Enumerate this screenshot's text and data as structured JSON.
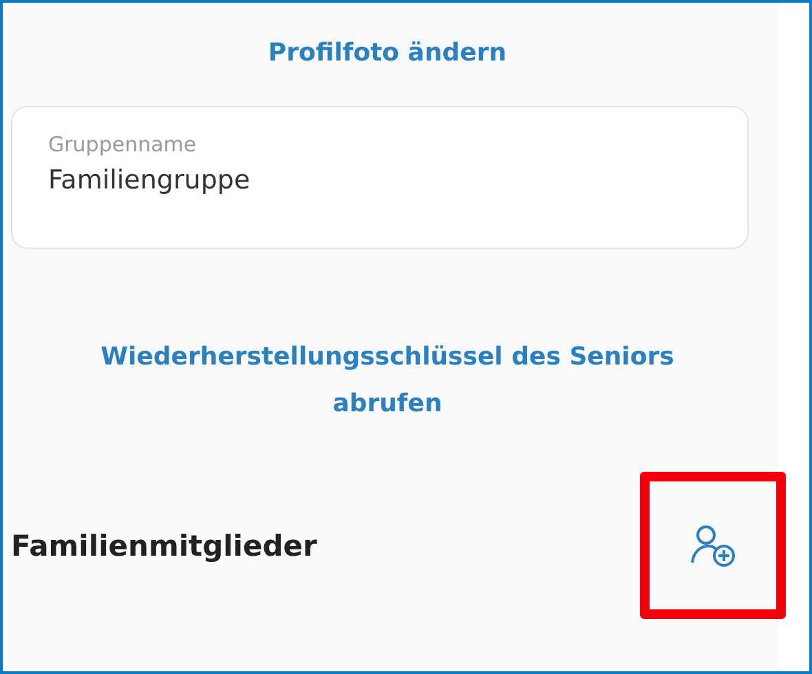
{
  "change_photo_link": "Profilfoto ändern",
  "group_name_field": {
    "label": "Gruppenname",
    "value": "Familiengruppe"
  },
  "recovery_key_link": "Wiederherstellungsschlüssel des Seniors abrufen",
  "members_section": {
    "title": "Familienmitglieder",
    "add_member_button": {
      "highlighted": true
    }
  }
}
